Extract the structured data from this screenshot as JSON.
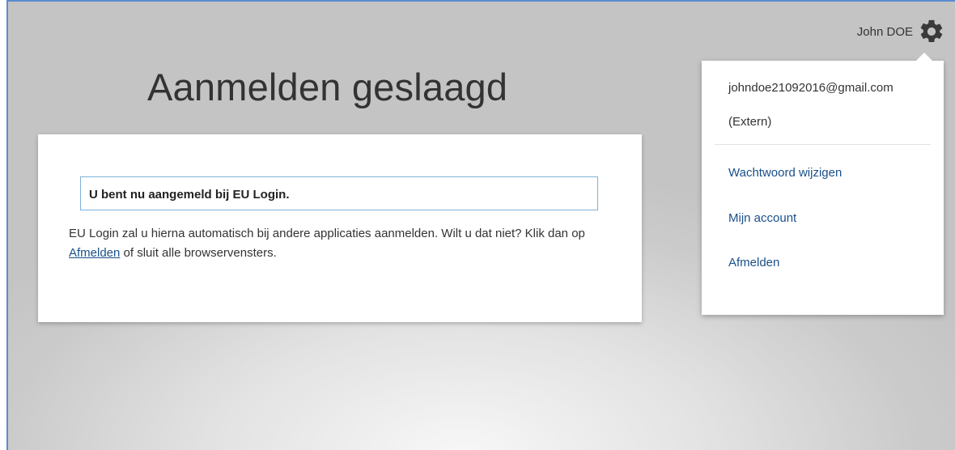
{
  "header": {
    "user_name": "John DOE",
    "settings_icon": "gear-icon"
  },
  "page": {
    "title": "Aanmelden geslaagd"
  },
  "card": {
    "notice": "U bent nu aangemeld bij EU Login.",
    "text_before_link": "EU Login zal u hierna automatisch bij andere applicaties aanmelden. Wilt u dat niet? Klik dan op ",
    "link_label": "Afmelden",
    "text_after_link": " of sluit alle browservensters."
  },
  "user_menu": {
    "email": "johndoe21092016@gmail.com",
    "account_type": "(Extern)",
    "items": [
      {
        "label": "Wachtwoord wijzigen"
      },
      {
        "label": "Mijn account"
      },
      {
        "label": "Afmelden"
      }
    ]
  },
  "colors": {
    "link": "#1a4f8a",
    "notice_border": "#7fb2d9",
    "frame_border": "#5b8bd0"
  }
}
